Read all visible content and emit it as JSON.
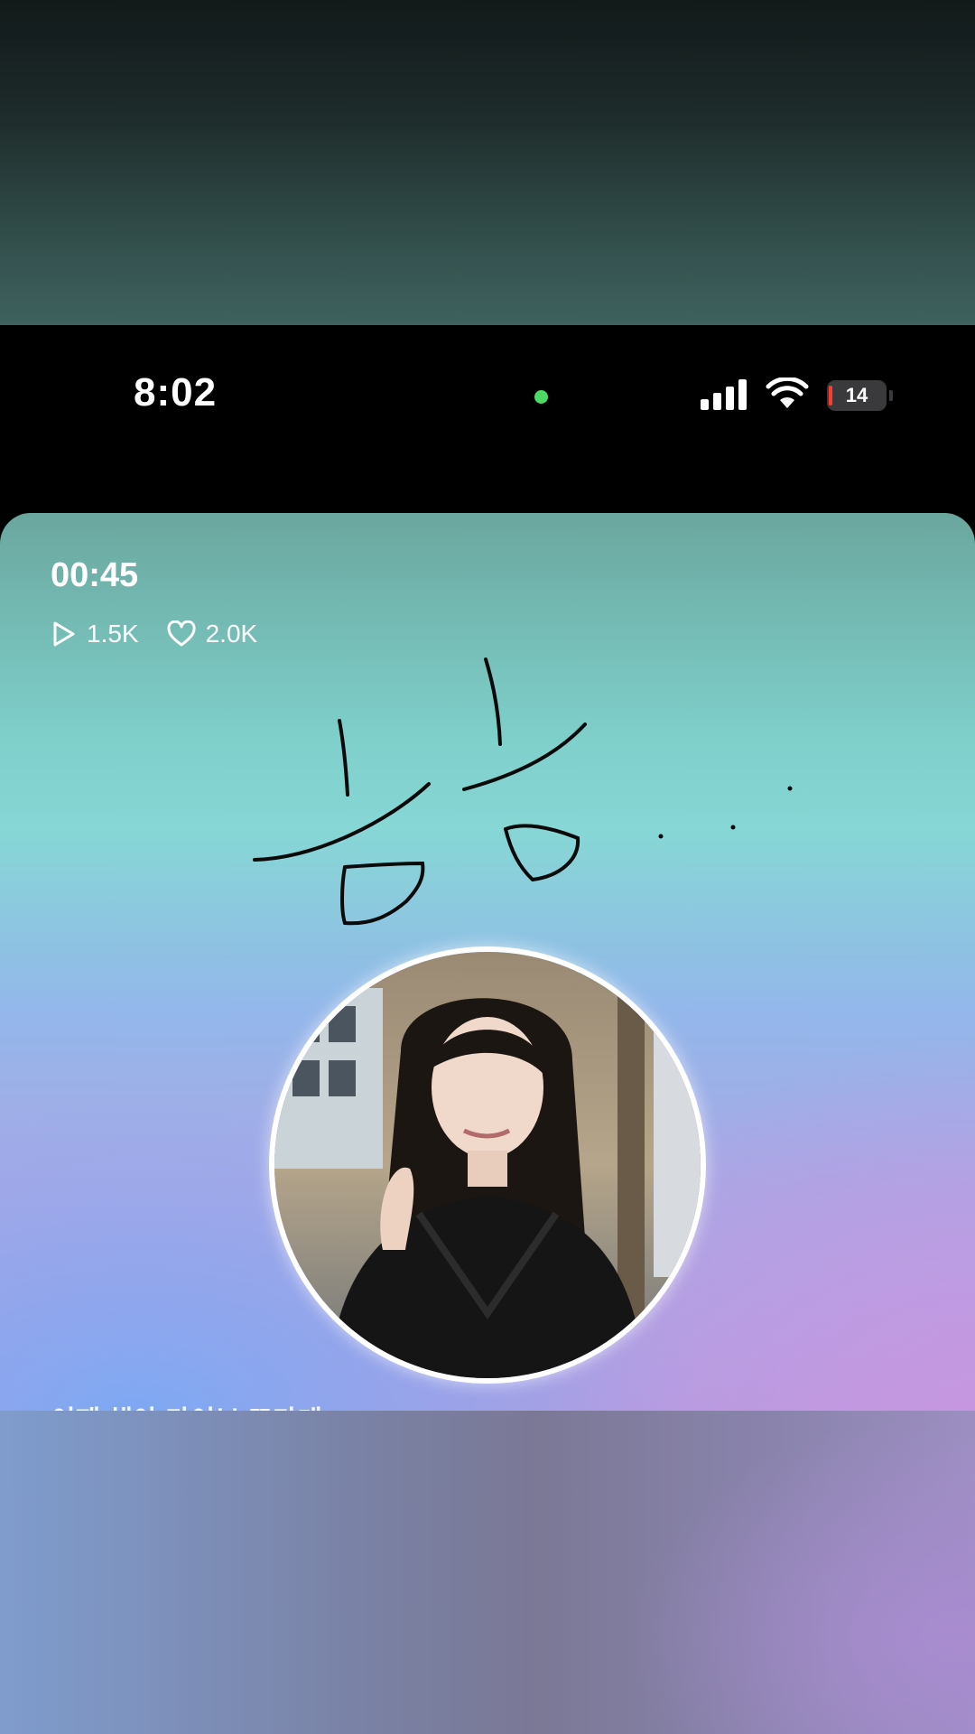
{
  "status_bar": {
    "time": "8:02",
    "battery": "14"
  },
  "player": {
    "timer": "00:45",
    "plays": "1.5K",
    "likes": "2.0K"
  },
  "caption": "이제 해야 가이브 또가게"
}
